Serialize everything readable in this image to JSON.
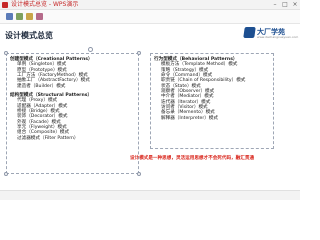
{
  "window": {
    "title": "设计模式总览 - WPS演示",
    "controls": [
      "min-icon",
      "max-icon",
      "close-icon"
    ]
  },
  "slide": {
    "title": "设计模式总览",
    "brand": {
      "name": "大厂学苑",
      "url": "www.dachangxueyuan.com"
    },
    "left_groups": [
      {
        "title": "创建型模式（Creational Patterns）",
        "items": [
          "单例（Singleton）模式",
          "原型（Prototype）模式",
          "工厂方法（FactoryMethod）模式",
          "抽象工厂（AbstractFactory）模式",
          "建造者（Builder）模式"
        ]
      },
      {
        "title": "结构型模式（Structural Patterns）",
        "items": [
          "代理（Proxy）模式",
          "适配器（Adapter）模式",
          "桥接（Bridge）模式",
          "装饰（Decorator）模式",
          "外观（Facade）模式",
          "享元（Flyweight）模式",
          "组合（Composite）模式",
          "过滤器模式（Filter Pattern）"
        ]
      }
    ],
    "right_group": {
      "title": "行为型模式（Behavioral Patterns）",
      "items": [
        "模板方法（Template Method）模式",
        "策略（Strategy）模式",
        "命令（Command）模式",
        "职责链（Chain of Responsibility）模式",
        "状态（State）模式",
        "观察者（Observer）模式",
        "中介者（Mediator）模式",
        "迭代器（Iterator）模式",
        "访问者（Visitor）模式",
        "备忘录（Memento）模式",
        "解释器（Interpreter）模式"
      ]
    },
    "note": "设计模式是一种思想，灵活运用思想才不会死代码，融汇贯通"
  },
  "colors": {
    "title": "#1f2b3d",
    "brand": "#1d4f91",
    "note": "#d9261c",
    "accent": "#c62828"
  }
}
